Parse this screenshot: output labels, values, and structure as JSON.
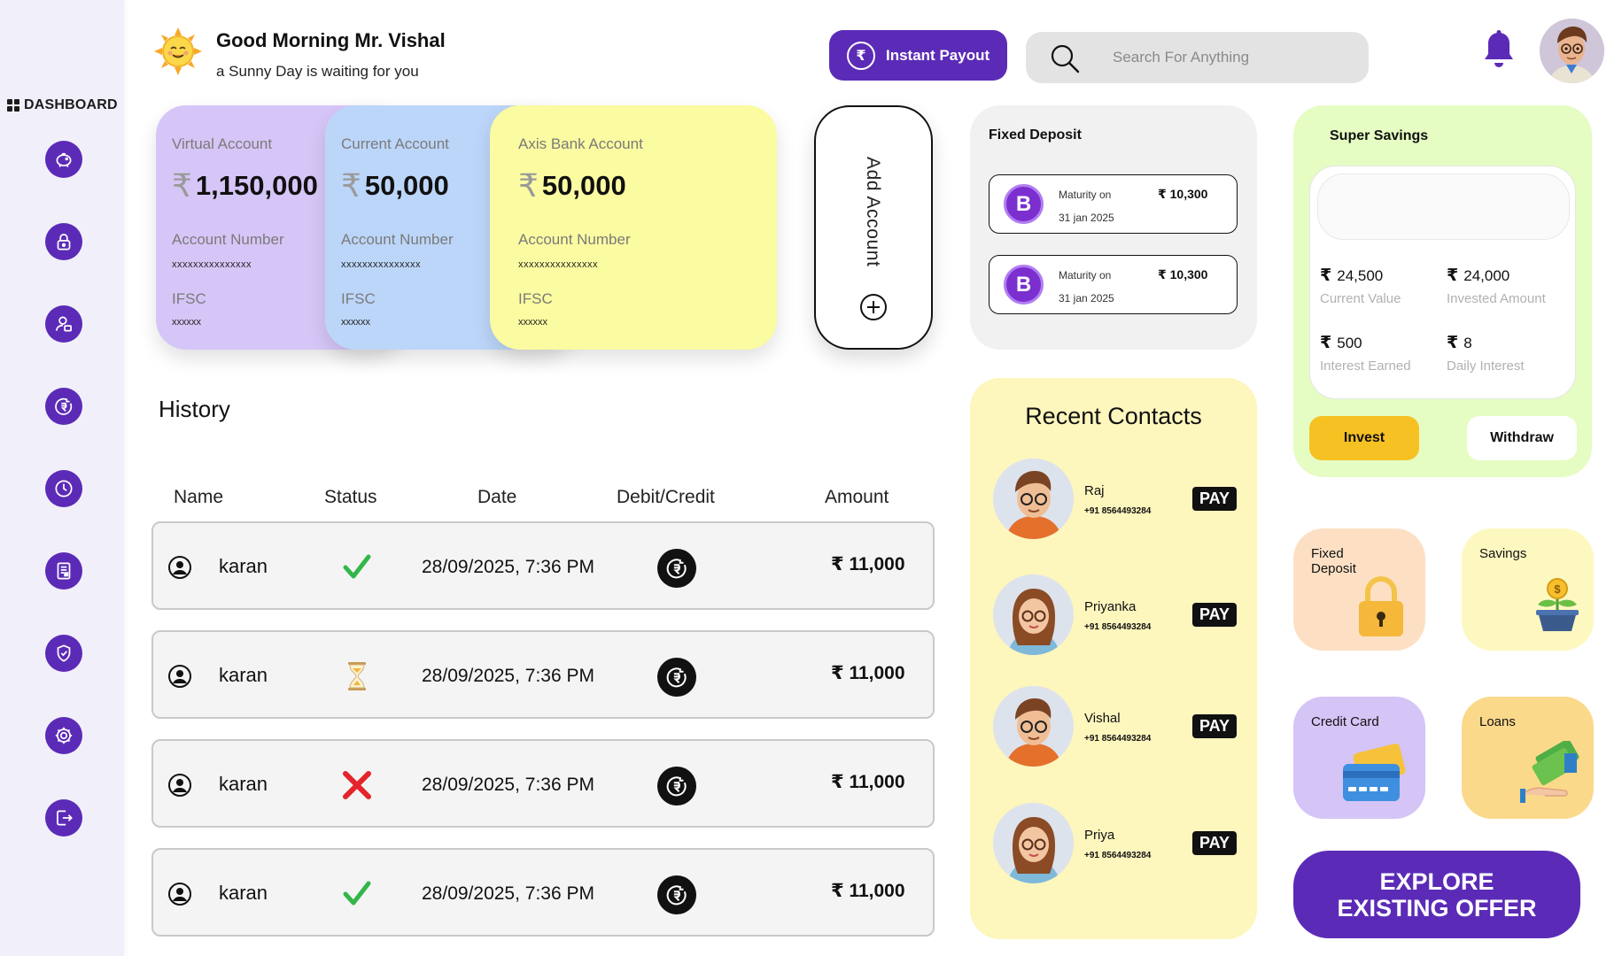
{
  "sidebar": {
    "title": "DASHBOARD",
    "items": [
      {
        "icon": "piggy-bank-icon"
      },
      {
        "icon": "lock-icon"
      },
      {
        "icon": "user-icon"
      },
      {
        "icon": "rupee-transfer-icon"
      },
      {
        "icon": "history-icon"
      },
      {
        "icon": "report-icon"
      },
      {
        "icon": "shield-icon"
      },
      {
        "icon": "gear-icon"
      },
      {
        "icon": "logout-icon"
      }
    ]
  },
  "header": {
    "greeting": "Good Morning Mr. Vishal",
    "subtitle": "a Sunny Day is waiting for you",
    "payout_label": "Instant Payout",
    "search_placeholder": "Search For Anything"
  },
  "accounts": [
    {
      "title": "Virtual Account",
      "amount": "1,150,000",
      "number_label": "Account Number",
      "number": "xxxxxxxxxxxxxxx",
      "ifsc_label": "IFSC",
      "ifsc": "xxxxxx",
      "color": "#d6c6f7"
    },
    {
      "title": "Current Account",
      "amount": "50,000",
      "number_label": "Account Number",
      "number": "xxxxxxxxxxxxxxx",
      "ifsc_label": "IFSC",
      "ifsc": "xxxxxx",
      "color": "#bcd6f9"
    },
    {
      "title": "Axis Bank Account",
      "amount": "50,000",
      "number_label": "Account Number",
      "number": "xxxxxxxxxxxxxxx",
      "ifsc_label": "IFSC",
      "ifsc": "xxxxxx",
      "color": "#fbfba1"
    }
  ],
  "add_account": {
    "label": "Add Account"
  },
  "fixed_deposit": {
    "title": "Fixed Deposit",
    "items": [
      {
        "maturity_label": "Maturity on",
        "date": "31 jan 2025",
        "value": "₹ 10,300"
      },
      {
        "maturity_label": "Maturity on",
        "date": "31 jan 2025",
        "value": "₹ 10,300"
      }
    ]
  },
  "super_savings": {
    "title": "Super Savings",
    "stats": [
      {
        "value": "24,500",
        "label": "Current Value"
      },
      {
        "value": "24,000",
        "label": "Invested Amount"
      },
      {
        "value": "500",
        "label": "Interest Earned"
      },
      {
        "value": "8",
        "label": "Daily Interest"
      }
    ],
    "invest_label": "Invest",
    "withdraw_label": "Withdraw"
  },
  "history": {
    "title": "History",
    "columns": [
      "Name",
      "Status",
      "Date",
      "Debit/Credit",
      "Amount"
    ],
    "rows": [
      {
        "name": "karan",
        "status": "success",
        "date": "28/09/2025, 7:36 PM",
        "amount": "₹ 11,000"
      },
      {
        "name": "karan",
        "status": "pending",
        "date": "28/09/2025, 7:36 PM",
        "amount": "₹ 11,000"
      },
      {
        "name": "karan",
        "status": "failed",
        "date": "28/09/2025, 7:36 PM",
        "amount": "₹ 11,000"
      },
      {
        "name": "karan",
        "status": "success",
        "date": "28/09/2025, 7:36 PM",
        "amount": "₹ 11,000"
      }
    ]
  },
  "recent_contacts": {
    "title": "Recent Contacts",
    "pay_label": "PAY",
    "items": [
      {
        "name": "Raj",
        "phone": "+91 8564493284"
      },
      {
        "name": "Priyanka",
        "phone": "+91 8564493284"
      },
      {
        "name": "Vishal",
        "phone": "+91 8564493284"
      },
      {
        "name": "Priya",
        "phone": "+91 8564493284"
      }
    ]
  },
  "tiles": {
    "fixed_deposit": "Fixed Deposit",
    "savings": "Savings",
    "credit_card": "Credit Card",
    "loans": "Loans"
  },
  "explore": {
    "line1": "EXPLORE",
    "line2": "EXISTING OFFER"
  },
  "colors": {
    "primary": "#5b2bb7",
    "invest": "#f6c123"
  }
}
